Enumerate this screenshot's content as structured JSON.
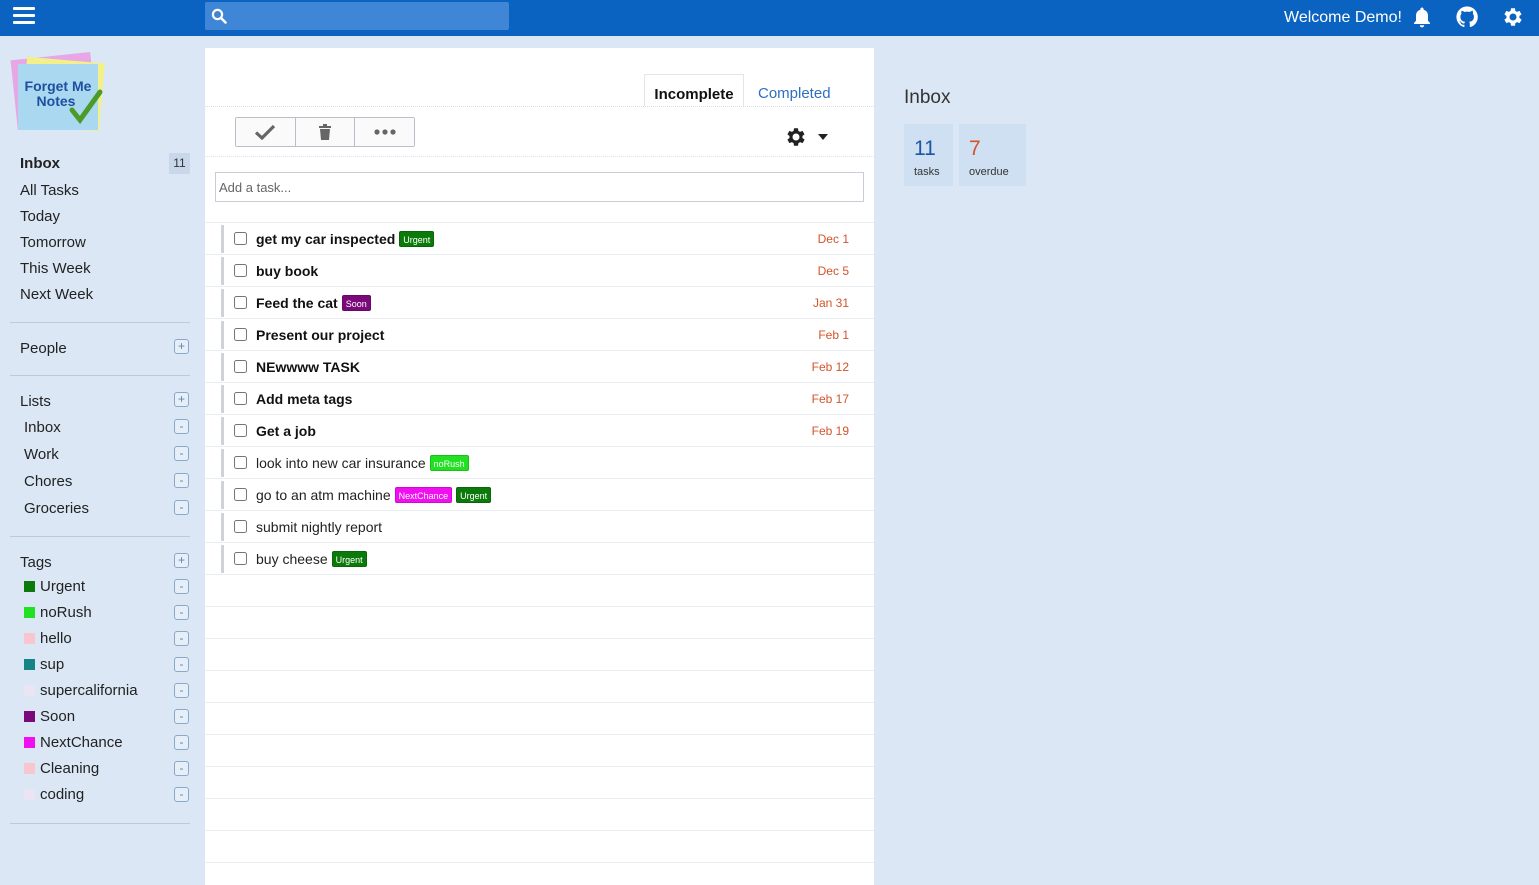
{
  "topbar": {
    "search_placeholder": "",
    "welcome": "Welcome Demo!",
    "color": "#0a63c0"
  },
  "logo": {
    "line1": "Forget Me",
    "line2": "Notes"
  },
  "sidebar": {
    "nav": [
      {
        "label": "Inbox",
        "active": true,
        "count": "11"
      },
      {
        "label": "All Tasks"
      },
      {
        "label": "Today"
      },
      {
        "label": "Tomorrow"
      },
      {
        "label": "This Week"
      },
      {
        "label": "Next Week"
      }
    ],
    "people": {
      "label": "People",
      "add": "+"
    },
    "lists": {
      "label": "Lists",
      "add": "+",
      "items": [
        "Inbox",
        "Work",
        "Chores",
        "Groceries"
      ],
      "remove": "-"
    },
    "tags": {
      "label": "Tags",
      "add": "+",
      "remove": "-",
      "items": [
        {
          "label": "Urgent",
          "color": "#0b7a0b"
        },
        {
          "label": "noRush",
          "color": "#22e022"
        },
        {
          "label": "hello",
          "color": "#f7c6cf"
        },
        {
          "label": "sup",
          "color": "#148484"
        },
        {
          "label": "supercalifornia",
          "color": "#ebe4f4"
        },
        {
          "label": "Soon",
          "color": "#7a0a7a"
        },
        {
          "label": "NextChance",
          "color": "#f00ff0"
        },
        {
          "label": "Cleaning",
          "color": "#f7c6cf"
        },
        {
          "label": "coding",
          "color": "#ebe4f4"
        }
      ]
    }
  },
  "main": {
    "tabs": {
      "incomplete": "Incomplete",
      "completed": "Completed"
    },
    "add_task_placeholder": "Add a task...",
    "tasks": [
      {
        "title": "get my car inspected",
        "bold": true,
        "date": "Dec 1",
        "tags": [
          {
            "label": "Urgent",
            "color": "#0b7a0b"
          }
        ]
      },
      {
        "title": "buy book",
        "bold": true,
        "date": "Dec 5",
        "tags": []
      },
      {
        "title": "Feed the cat",
        "bold": true,
        "date": "Jan 31",
        "tags": [
          {
            "label": "Soon",
            "color": "#7a0a7a"
          }
        ]
      },
      {
        "title": "Present our project",
        "bold": true,
        "date": "Feb 1",
        "tags": []
      },
      {
        "title": "NEwwww TASK",
        "bold": true,
        "date": "Feb 12",
        "tags": []
      },
      {
        "title": "Add meta tags",
        "bold": true,
        "date": "Feb 17",
        "tags": []
      },
      {
        "title": "Get a job",
        "bold": true,
        "date": "Feb 19",
        "tags": []
      },
      {
        "title": "look into new car insurance",
        "bold": false,
        "date": "",
        "tags": [
          {
            "label": "noRush",
            "color": "#22e022"
          }
        ]
      },
      {
        "title": "go to an atm machine",
        "bold": false,
        "date": "",
        "tags": [
          {
            "label": "NextChance",
            "color": "#f00ff0"
          },
          {
            "label": "Urgent",
            "color": "#0b7a0b"
          }
        ]
      },
      {
        "title": "submit nightly report",
        "bold": false,
        "date": "",
        "tags": []
      },
      {
        "title": "buy cheese",
        "bold": false,
        "date": "",
        "tags": [
          {
            "label": "Urgent",
            "color": "#0b7a0b"
          }
        ]
      }
    ]
  },
  "detail": {
    "title": "Inbox",
    "tasks_count": "11",
    "tasks_label": "tasks",
    "overdue_count": "7",
    "overdue_label": "overdue",
    "tasks_color": "#1a56a8",
    "overdue_color": "#d4532a"
  }
}
